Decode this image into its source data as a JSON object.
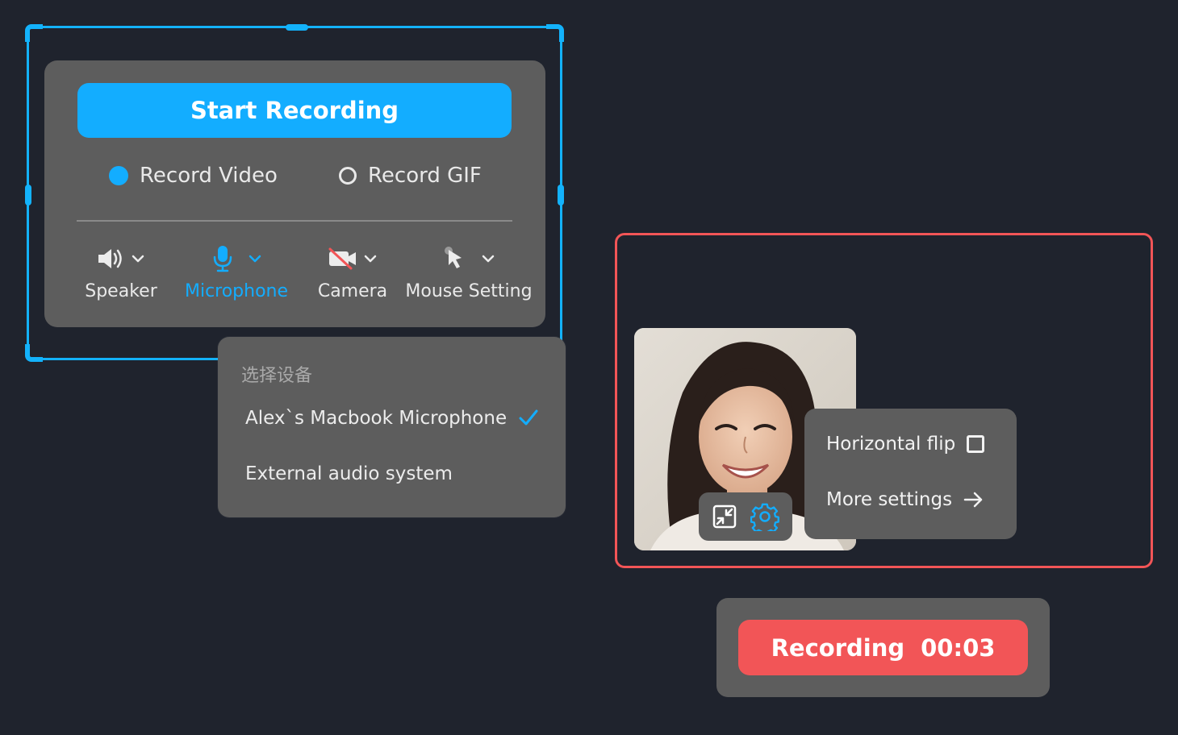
{
  "recorder": {
    "start_label": "Start Recording",
    "modes": {
      "video_label": "Record Video",
      "gif_label": "Record GIF",
      "selected": "video"
    },
    "devices": {
      "speaker_label": "Speaker",
      "microphone_label": "Microphone",
      "camera_label": "Camera",
      "mouse_label": "Mouse Setting"
    }
  },
  "device_menu": {
    "title": "选择设备",
    "items": [
      {
        "label": "Alex`s Macbook Microphone",
        "selected": true
      },
      {
        "label": "External audio system",
        "selected": false
      }
    ]
  },
  "camera_menu": {
    "flip_label": "Horizontal flip",
    "flip_checked": false,
    "more_label": "More settings"
  },
  "recording": {
    "label": "Recording",
    "time": "00:03"
  },
  "colors": {
    "background": "#1f232d",
    "panel": "#5d5d5d",
    "accent_blue": "#13adff",
    "accent_red": "#f25557"
  }
}
